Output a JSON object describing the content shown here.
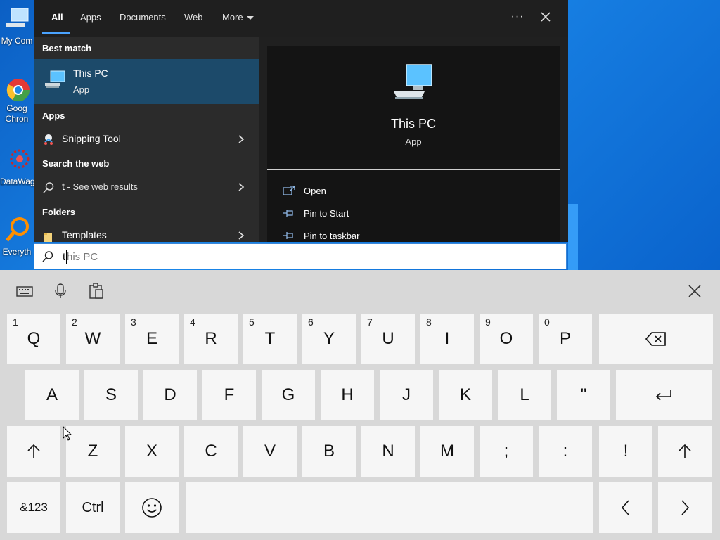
{
  "desktop": {
    "icons": [
      {
        "name": "my-computer-icon",
        "label": "My Com"
      },
      {
        "name": "google-chrome-icon",
        "label": "Goog\nChron"
      },
      {
        "name": "datawagon-icon",
        "label": "DataWag"
      },
      {
        "name": "everything-icon",
        "label": "Everyth"
      }
    ]
  },
  "search": {
    "tabs": [
      "All",
      "Apps",
      "Documents",
      "Web",
      "More"
    ],
    "active_tab": "All",
    "sections": {
      "best_match": "Best match",
      "apps": "Apps",
      "search_web": "Search the web",
      "folders": "Folders"
    },
    "best_match": {
      "title": "This PC",
      "subtitle": "App"
    },
    "apps": [
      {
        "label": "Snipping Tool"
      }
    ],
    "web": {
      "query": "t",
      "suffix": " - See web results"
    },
    "folders": [
      {
        "label": "Templates"
      }
    ],
    "preview": {
      "title": "This PC",
      "subtitle": "App",
      "actions": [
        "Open",
        "Pin to Start",
        "Pin to taskbar"
      ]
    },
    "input": {
      "typed": "t",
      "completion": "his PC"
    }
  },
  "keyboard": {
    "rows": [
      [
        {
          "k": "Q",
          "n": "1"
        },
        {
          "k": "W",
          "n": "2"
        },
        {
          "k": "E",
          "n": "3"
        },
        {
          "k": "R",
          "n": "4"
        },
        {
          "k": "T",
          "n": "5"
        },
        {
          "k": "Y",
          "n": "6"
        },
        {
          "k": "U",
          "n": "7"
        },
        {
          "k": "I",
          "n": "8"
        },
        {
          "k": "O",
          "n": "9"
        },
        {
          "k": "P",
          "n": "0"
        }
      ],
      [
        {
          "k": "A"
        },
        {
          "k": "S"
        },
        {
          "k": "D"
        },
        {
          "k": "F"
        },
        {
          "k": "G"
        },
        {
          "k": "H"
        },
        {
          "k": "J"
        },
        {
          "k": "K"
        },
        {
          "k": "L"
        },
        {
          "k": "\""
        }
      ],
      [
        {
          "k": "Z"
        },
        {
          "k": "X"
        },
        {
          "k": "C"
        },
        {
          "k": "V"
        },
        {
          "k": "B"
        },
        {
          "k": "N"
        },
        {
          "k": "M"
        },
        {
          "k": ";"
        },
        {
          "k": ":"
        },
        {
          "k": "!"
        }
      ]
    ],
    "symbols_label": "&123",
    "ctrl_label": "Ctrl"
  }
}
